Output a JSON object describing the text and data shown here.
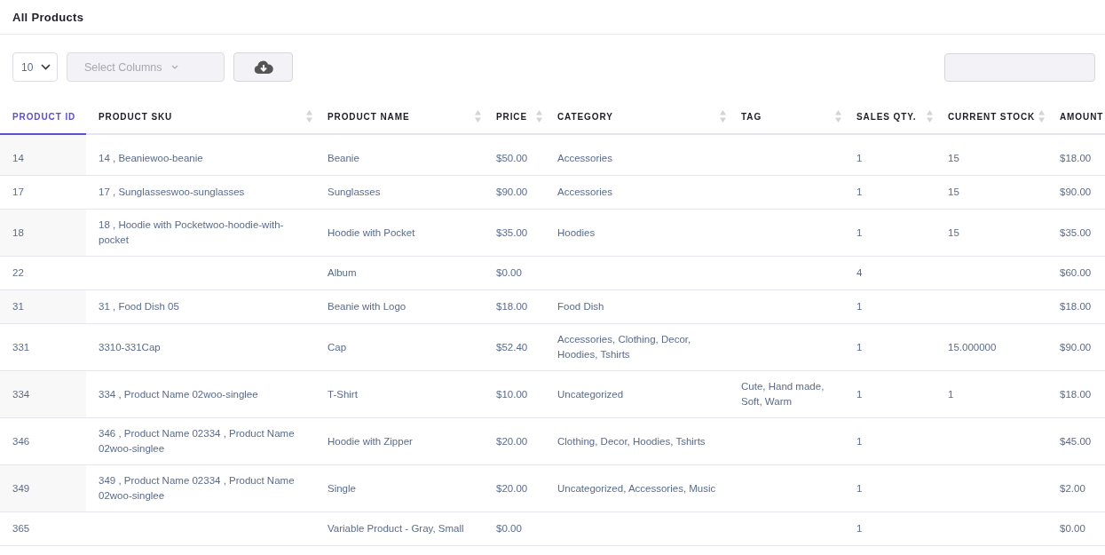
{
  "title": "All Products",
  "toolbar": {
    "page_size": "10",
    "columns_placeholder": "Select Columns"
  },
  "table": {
    "columns": [
      {
        "label": "PRODUCT ID",
        "sorted": true
      },
      {
        "label": "PRODUCT SKU",
        "sorted": false
      },
      {
        "label": "PRODUCT NAME",
        "sorted": false
      },
      {
        "label": "PRICE",
        "sorted": false
      },
      {
        "label": "CATEGORY",
        "sorted": false
      },
      {
        "label": "TAG",
        "sorted": false
      },
      {
        "label": "SALES QTY.",
        "sorted": false
      },
      {
        "label": "CURRENT STOCK",
        "sorted": false
      },
      {
        "label": "AMOUNT",
        "sorted": false
      }
    ],
    "rows": [
      [
        "14",
        "14 , Beaniewoo-beanie",
        "Beanie",
        "$50.00",
        "Accessories",
        "",
        "1",
        "15",
        "$18.00"
      ],
      [
        "17",
        "17 , Sunglasseswoo-sunglasses",
        "Sunglasses",
        "$90.00",
        "Accessories",
        "",
        "1",
        "15",
        "$90.00"
      ],
      [
        "18",
        "18 , Hoodie with Pocketwoo-hoodie-with-pocket",
        "Hoodie with Pocket",
        "$35.00",
        "Hoodies",
        "",
        "1",
        "15",
        "$35.00"
      ],
      [
        "22",
        "",
        "Album",
        "$0.00",
        "",
        "",
        "4",
        "",
        "$60.00"
      ],
      [
        "31",
        "31 , Food Dish 05",
        "Beanie with Logo",
        "$18.00",
        "Food Dish",
        "",
        "1",
        "",
        "$18.00"
      ],
      [
        "331",
        "3310-331Cap",
        "Cap",
        "$52.40",
        "Accessories, Clothing, Decor, Hoodies, Tshirts",
        "",
        "1",
        "15.000000",
        "$90.00"
      ],
      [
        "334",
        "334 , Product Name 02woo-singlee",
        "T-Shirt",
        "$10.00",
        "Uncategorized",
        "Cute, Hand made, Soft, Warm",
        "1",
        "1",
        "$18.00"
      ],
      [
        "346",
        "346 , Product Name 02334 , Product Name 02woo-singlee",
        "Hoodie with Zipper",
        "$20.00",
        "Clothing, Decor, Hoodies, Tshirts",
        "",
        "1",
        "",
        "$45.00"
      ],
      [
        "349",
        "349 , Product Name 02334 , Product Name 02woo-singlee",
        "Single",
        "$20.00",
        "Uncategorized, Accessories, Music",
        "",
        "1",
        "",
        "$2.00"
      ],
      [
        "365",
        "",
        "Variable Product - Gray, Small",
        "$0.00",
        "",
        "",
        "1",
        "",
        "$0.00"
      ]
    ]
  }
}
